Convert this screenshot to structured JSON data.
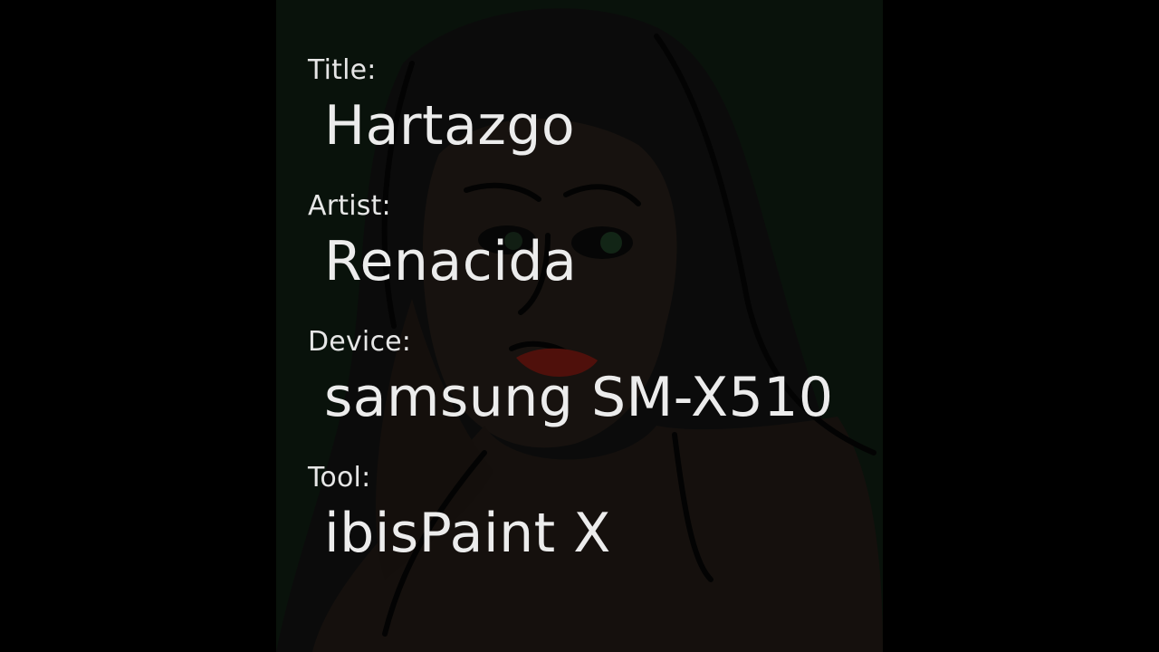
{
  "colors": {
    "background": "#000000",
    "canvas_bg": "#0f1a10",
    "text": "#ececec",
    "lips": "#7a1a12"
  },
  "info": {
    "title_label": "Title:",
    "title_value": "Hartazgo",
    "artist_label": "Artist:",
    "artist_value": "Renacida",
    "device_label": "Device:",
    "device_value": "samsung SM-X510",
    "tool_label": "Tool:",
    "tool_value": "ibisPaint X"
  }
}
